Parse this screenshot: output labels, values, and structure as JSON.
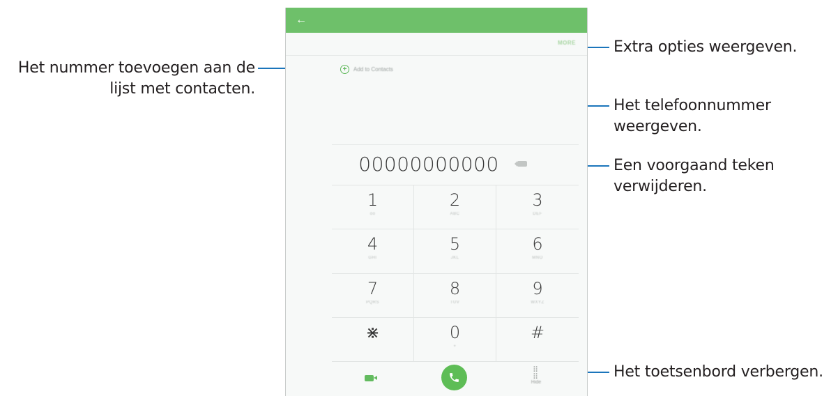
{
  "callouts": {
    "add_contact": [
      "Het nummer toevoegen aan de",
      "lijst met contacten."
    ],
    "more_options": "Extra opties weergeven.",
    "show_number": [
      "Het telefoonnummer",
      "weergeven."
    ],
    "delete_char": [
      "Een voorgaand teken",
      "verwijderen."
    ],
    "hide_keypad": "Het toetsenbord verbergen."
  },
  "screen": {
    "back_icon": "←",
    "more_label": "MORE",
    "add_to_contacts_label": "Add to Contacts",
    "phone_number": "00000000000",
    "keys": [
      {
        "digit": "1",
        "letters": "oo"
      },
      {
        "digit": "2",
        "letters": "ABC"
      },
      {
        "digit": "3",
        "letters": "DEF"
      },
      {
        "digit": "4",
        "letters": "GHI"
      },
      {
        "digit": "5",
        "letters": "JKL"
      },
      {
        "digit": "6",
        "letters": "MNO"
      },
      {
        "digit": "7",
        "letters": "PQRS"
      },
      {
        "digit": "8",
        "letters": "TUV"
      },
      {
        "digit": "9",
        "letters": "WXYZ"
      },
      {
        "digit": "⋇",
        "letters": ""
      },
      {
        "digit": "0",
        "letters": "+"
      },
      {
        "digit": "#",
        "letters": ""
      }
    ],
    "hide_label": "Hide",
    "icons": {
      "back": "back-arrow-icon",
      "add": "add-contact-icon",
      "delete": "backspace-icon",
      "video": "video-call-icon",
      "call": "phone-call-icon",
      "keypad": "keypad-icon"
    },
    "colors": {
      "appbar": "#6ec06a",
      "accent": "#5ebd56",
      "leader": "#1b75bb"
    }
  }
}
